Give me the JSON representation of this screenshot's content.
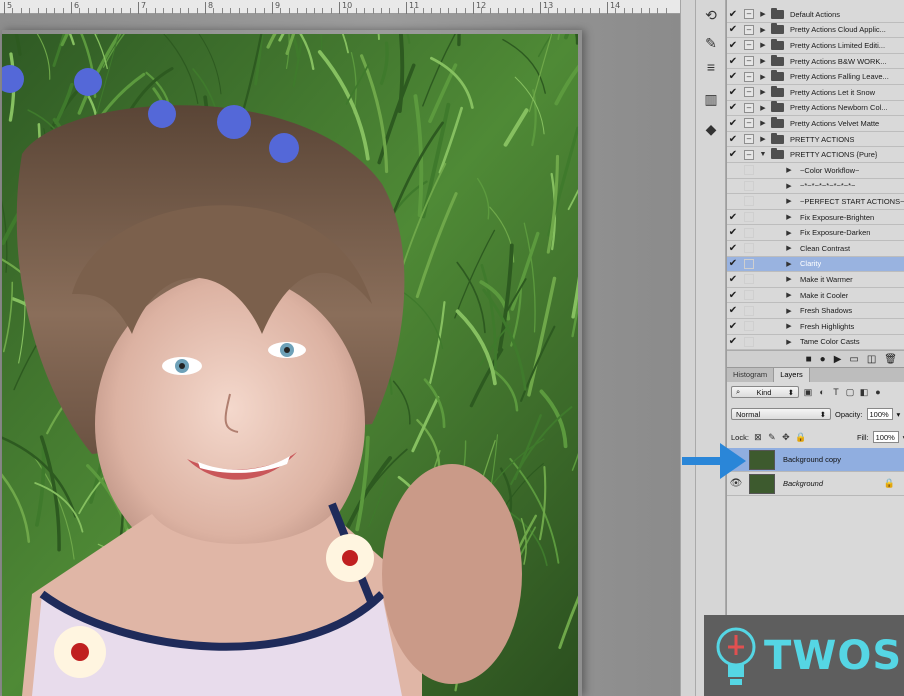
{
  "ruler": {
    "numbers": [
      "5",
      "6",
      "7",
      "8",
      "9",
      "10",
      "11",
      "12",
      "13",
      "14"
    ]
  },
  "actions": {
    "rows": [
      {
        "label": "Default Actions",
        "checked": true,
        "box": true,
        "folder": true,
        "expanded": false,
        "child": false,
        "selected": false
      },
      {
        "label": "Pretty Actions Cloud Applic...",
        "checked": true,
        "box": true,
        "folder": true,
        "expanded": false,
        "child": false,
        "selected": false
      },
      {
        "label": "Pretty Actions Limited Editi...",
        "checked": true,
        "box": true,
        "folder": true,
        "expanded": false,
        "child": false,
        "selected": false
      },
      {
        "label": "Pretty Actions B&W WORK...",
        "checked": true,
        "box": true,
        "folder": true,
        "expanded": false,
        "child": false,
        "selected": false
      },
      {
        "label": "Pretty Actions Falling Leave...",
        "checked": true,
        "box": true,
        "folder": true,
        "expanded": false,
        "child": false,
        "selected": false
      },
      {
        "label": "Pretty Actions Let it Snow",
        "checked": true,
        "box": true,
        "folder": true,
        "expanded": false,
        "child": false,
        "selected": false
      },
      {
        "label": "Pretty Actions Newborn Col...",
        "checked": true,
        "box": true,
        "folder": true,
        "expanded": false,
        "child": false,
        "selected": false
      },
      {
        "label": "Pretty Actions Velvet Matte",
        "checked": true,
        "box": true,
        "folder": true,
        "expanded": false,
        "child": false,
        "selected": false
      },
      {
        "label": "PRETTY ACTIONS",
        "checked": true,
        "box": true,
        "folder": true,
        "expanded": false,
        "child": false,
        "selected": false
      },
      {
        "label": "PRETTY ACTIONS {Pure}",
        "checked": true,
        "box": true,
        "folder": true,
        "expanded": true,
        "child": false,
        "selected": false
      },
      {
        "label": "~Color Workflow~",
        "checked": false,
        "box": false,
        "folder": false,
        "expanded": false,
        "child": true,
        "selected": false
      },
      {
        "label": "~*~*~*~*~*~*~*~",
        "checked": false,
        "box": false,
        "folder": false,
        "expanded": false,
        "child": true,
        "selected": false
      },
      {
        "label": "~PERFECT START ACTIONS~",
        "checked": false,
        "box": false,
        "folder": false,
        "expanded": false,
        "child": true,
        "selected": false
      },
      {
        "label": "Fix Exposure-Brighten",
        "checked": true,
        "box": false,
        "folder": false,
        "expanded": false,
        "child": true,
        "selected": false
      },
      {
        "label": "Fix Exposure-Darken",
        "checked": true,
        "box": false,
        "folder": false,
        "expanded": false,
        "child": true,
        "selected": false
      },
      {
        "label": "Clean Contrast",
        "checked": true,
        "box": false,
        "folder": false,
        "expanded": false,
        "child": true,
        "selected": false
      },
      {
        "label": "Clarity",
        "checked": true,
        "box": false,
        "folder": false,
        "expanded": false,
        "child": true,
        "selected": true
      },
      {
        "label": "Make it Warmer",
        "checked": true,
        "box": false,
        "folder": false,
        "expanded": false,
        "child": true,
        "selected": false
      },
      {
        "label": "Make it Cooler",
        "checked": true,
        "box": false,
        "folder": false,
        "expanded": false,
        "child": true,
        "selected": false
      },
      {
        "label": "Fresh Shadows",
        "checked": true,
        "box": false,
        "folder": false,
        "expanded": false,
        "child": true,
        "selected": false
      },
      {
        "label": "Fresh Highlights",
        "checked": true,
        "box": false,
        "folder": false,
        "expanded": false,
        "child": true,
        "selected": false
      },
      {
        "label": "Tame Color Casts",
        "checked": true,
        "box": false,
        "folder": false,
        "expanded": false,
        "child": true,
        "selected": false
      }
    ],
    "footer_icons": [
      "stop-icon",
      "record-icon",
      "play-icon",
      "new-set-icon",
      "new-action-icon",
      "delete-icon"
    ]
  },
  "layers": {
    "tabs": [
      "Histogram",
      "Layers"
    ],
    "active_tab": "Layers",
    "filter_kind": "Kind",
    "blend_mode": "Normal",
    "opacity_label": "Opacity:",
    "opacity_value": "100%",
    "lock_label": "Lock:",
    "fill_label": "Fill:",
    "fill_value": "100%",
    "items": [
      {
        "name": "Background copy",
        "selected": true,
        "visible": false,
        "locked": false
      },
      {
        "name": "Background",
        "selected": false,
        "visible": true,
        "locked": true
      }
    ]
  },
  "watermark": {
    "text": "TWOS"
  },
  "colors": {
    "arrow": "#2a86d8",
    "selection": "#99b3e0",
    "watermark_text": "#55d6e4"
  }
}
